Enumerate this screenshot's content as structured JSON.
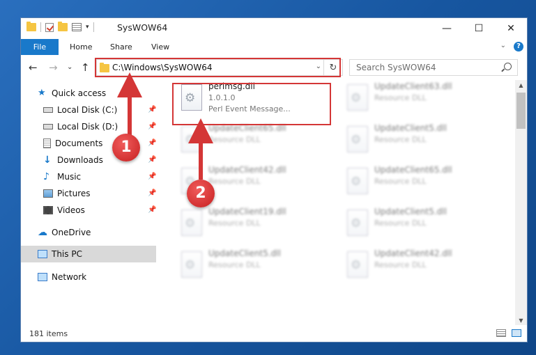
{
  "window": {
    "title": "SysWOW64",
    "controls": {
      "minimize": "—",
      "maximize": "☐",
      "close": "✕"
    }
  },
  "ribbon": {
    "tabs": [
      "File",
      "Home",
      "Share",
      "View"
    ],
    "help": "?",
    "expand": "⌄"
  },
  "nav": {
    "back": "←",
    "forward": "→",
    "recent": "⌄",
    "up": "↑",
    "address": "C:\\Windows\\SysWOW64",
    "address_dropdown": "⌄",
    "refresh": "↻",
    "search_placeholder": "Search SysWOW64"
  },
  "sidebar": {
    "quick_access": "Quick access",
    "pinned": [
      {
        "label": "Local Disk (C:)",
        "icon": "drive-icon"
      },
      {
        "label": "Local Disk (D:)",
        "icon": "drive-icon"
      },
      {
        "label": "Documents",
        "icon": "documents-icon"
      },
      {
        "label": "Downloads",
        "icon": "downloads-icon"
      },
      {
        "label": "Music",
        "icon": "music-icon"
      },
      {
        "label": "Pictures",
        "icon": "pictures-icon"
      },
      {
        "label": "Videos",
        "icon": "videos-icon"
      }
    ],
    "pin_glyph": "📌",
    "onedrive": "OneDrive",
    "this_pc": "This PC",
    "network": "Network"
  },
  "files": [
    {
      "name": "perlmsg.dll",
      "line2": "1.0.1.0",
      "line3": "Perl Event Message...",
      "highlighted": true
    },
    {
      "name": "UpdateClient63.dll",
      "line2": "Resource DLL"
    },
    {
      "name": "UpdateClient65.dll",
      "line2": "Resource DLL"
    },
    {
      "name": "UpdateClient5.dll",
      "line2": "Resource DLL"
    },
    {
      "name": "UpdateClient42.dll",
      "line2": "Resource DLL"
    },
    {
      "name": "UpdateClient65.dll",
      "line2": "Resource DLL"
    },
    {
      "name": "UpdateClient19.dll",
      "line2": "Resource DLL"
    },
    {
      "name": "UpdateClient5.dll",
      "line2": "Resource DLL"
    },
    {
      "name": "UpdateClient5.dll",
      "line2": "Resource DLL"
    },
    {
      "name": "UpdateClient42.dll",
      "line2": "Resource DLL"
    }
  ],
  "status": {
    "item_count": "181 items"
  },
  "annotations": {
    "step1": "1",
    "step2": "2"
  },
  "colors": {
    "accent": "#1979ca",
    "annotation_red": "#d43636"
  }
}
